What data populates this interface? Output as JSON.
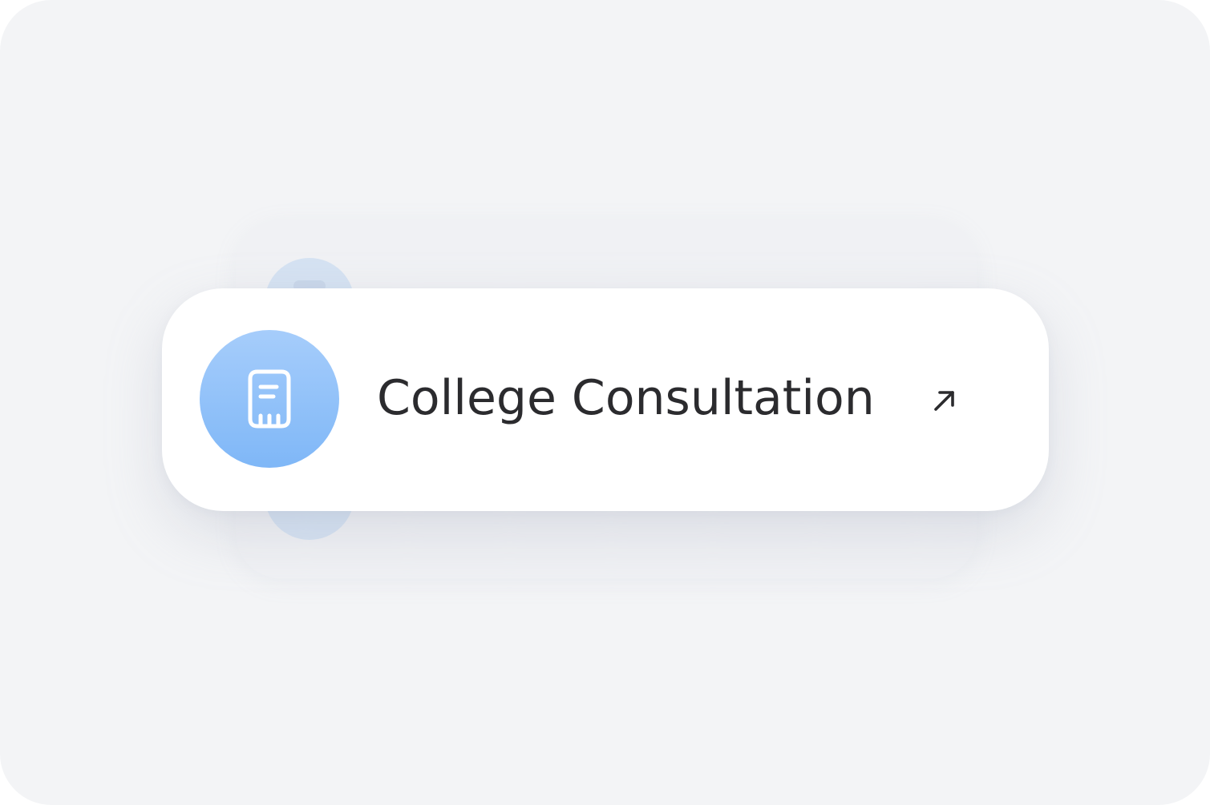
{
  "card": {
    "title": "College Consultation",
    "icon": "document-icon",
    "action_icon": "arrow-up-right-icon"
  },
  "colors": {
    "background": "#f3f4f6",
    "card": "#ffffff",
    "icon_gradient_top": "#a6cdfb",
    "icon_gradient_bottom": "#7fb7f7",
    "title_text": "#2b2b2e"
  }
}
